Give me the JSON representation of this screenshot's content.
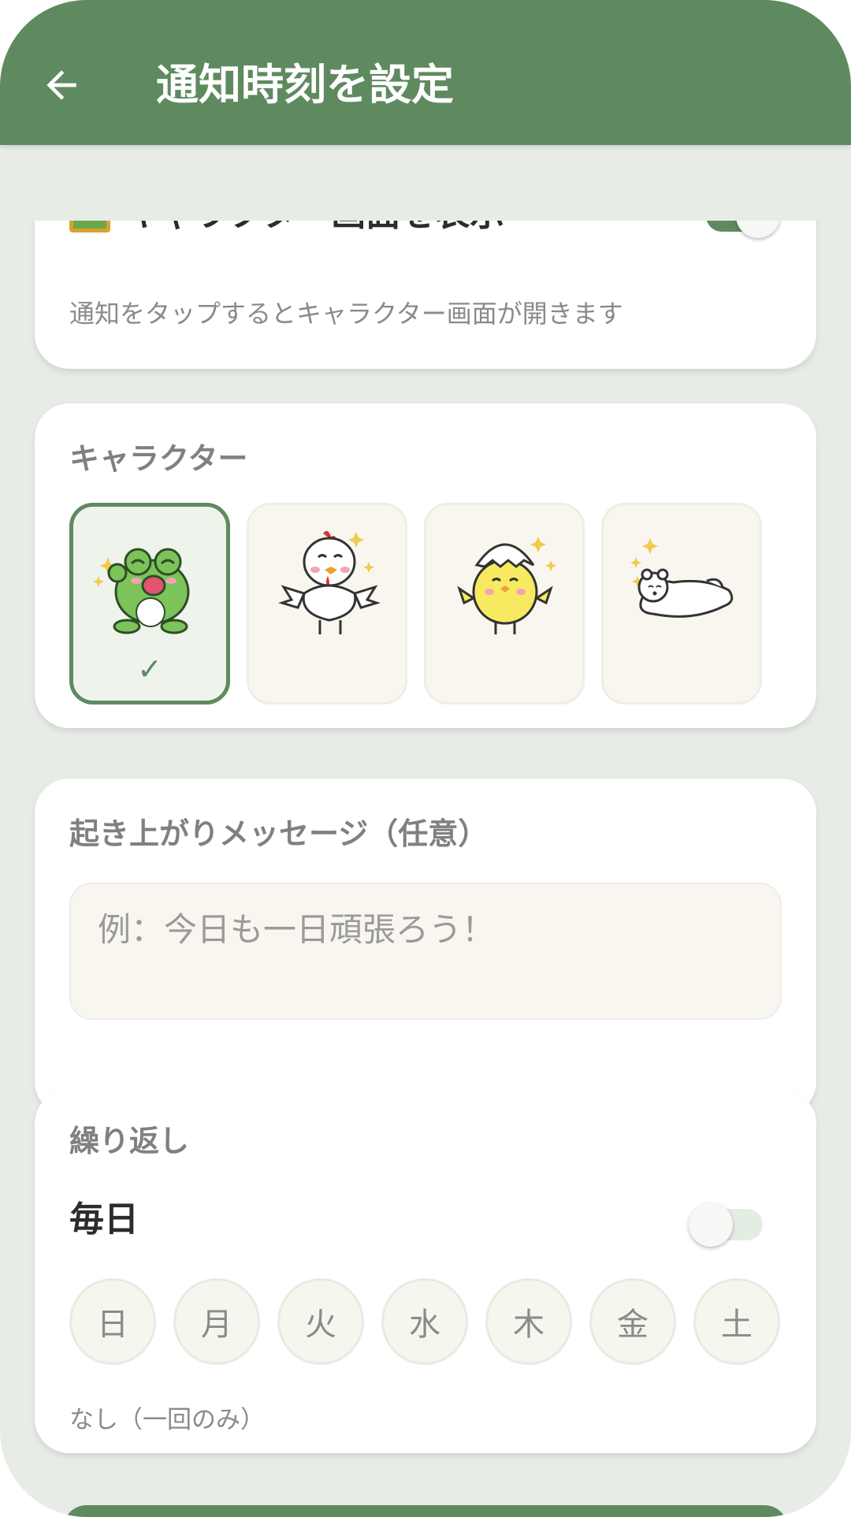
{
  "appbar": {
    "title": "通知時刻を設定"
  },
  "show_character": {
    "label": "キャラクター画面を表示",
    "icon": "framed-picture-icon",
    "enabled": true,
    "hint": "通知をタップするとキャラクター画面が開きます"
  },
  "character": {
    "label": "キャラクター",
    "check_mark": "✓",
    "options": [
      {
        "name": "frog",
        "selected": true
      },
      {
        "name": "chicken",
        "selected": false
      },
      {
        "name": "chick",
        "selected": false
      },
      {
        "name": "polar-bear",
        "selected": false
      }
    ]
  },
  "message": {
    "label": "起き上がりメッセージ（任意）",
    "placeholder": "例：今日も一日頑張ろう！"
  },
  "repeat": {
    "label": "繰り返し",
    "daily_label": "毎日",
    "daily_enabled": false,
    "days": [
      "日",
      "月",
      "火",
      "水",
      "木",
      "金",
      "土"
    ],
    "summary": "なし（一回のみ）"
  },
  "colors": {
    "primary": "#5f8a60",
    "background": "#e8ece6",
    "tile": "#f8f6ef"
  }
}
